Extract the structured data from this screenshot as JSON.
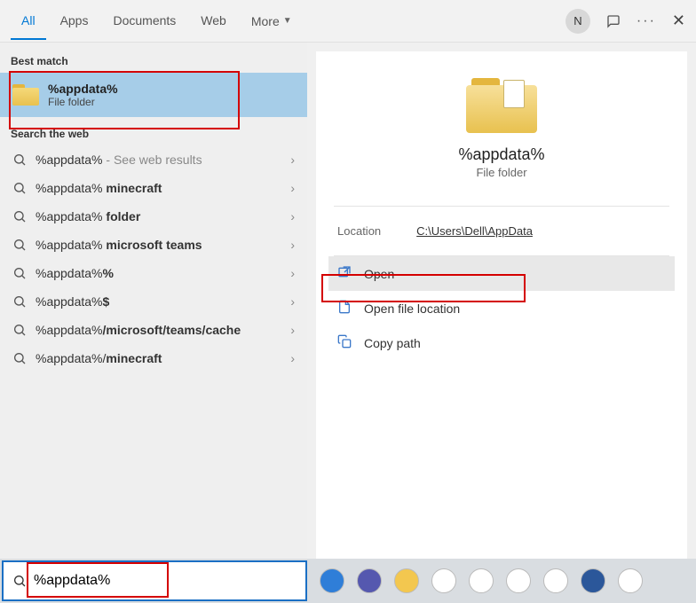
{
  "topbar": {
    "tabs": [
      "All",
      "Apps",
      "Documents",
      "Web",
      "More"
    ],
    "active_tab": 0,
    "avatar_letter": "N"
  },
  "left": {
    "best_match_label": "Best match",
    "best_match": {
      "title": "%appdata%",
      "sub": "File folder"
    },
    "search_web_label": "Search the web",
    "web_results": [
      {
        "text": "%appdata%",
        "hint": " - See web results"
      },
      {
        "text": "%appdata% ",
        "bold": "minecraft"
      },
      {
        "text": "%appdata% ",
        "bold": "folder"
      },
      {
        "text": "%appdata% ",
        "bold": "microsoft teams"
      },
      {
        "text": "%appdata%",
        "bold": "%"
      },
      {
        "text": "%appdata%",
        "bold": "$"
      },
      {
        "text": "%appdata%",
        "bold": "/microsoft/teams/cache"
      },
      {
        "text": "%appdata%/",
        "bold": "minecraft"
      }
    ]
  },
  "right": {
    "title": "%appdata%",
    "sub": "File folder",
    "location_label": "Location",
    "location_value": "C:\\Users\\Dell\\AppData",
    "actions": [
      {
        "icon": "open",
        "label": "Open",
        "highlight": true
      },
      {
        "icon": "file-location",
        "label": "Open file location",
        "highlight": false
      },
      {
        "icon": "copy",
        "label": "Copy path",
        "highlight": false
      }
    ]
  },
  "taskbar": {
    "search_value": "%appdata%",
    "icons": [
      {
        "name": "edge",
        "bg": "#2f7ed8"
      },
      {
        "name": "teams",
        "bg": "#5558af"
      },
      {
        "name": "explorer",
        "bg": "#f3c74f"
      },
      {
        "name": "chrome",
        "bg": "#ffffff"
      },
      {
        "name": "slack",
        "bg": "#ffffff"
      },
      {
        "name": "chrome2",
        "bg": "#ffffff"
      },
      {
        "name": "paint",
        "bg": "#ffffff"
      },
      {
        "name": "word",
        "bg": "#2b579a"
      },
      {
        "name": "palette",
        "bg": "#ffffff"
      }
    ]
  }
}
